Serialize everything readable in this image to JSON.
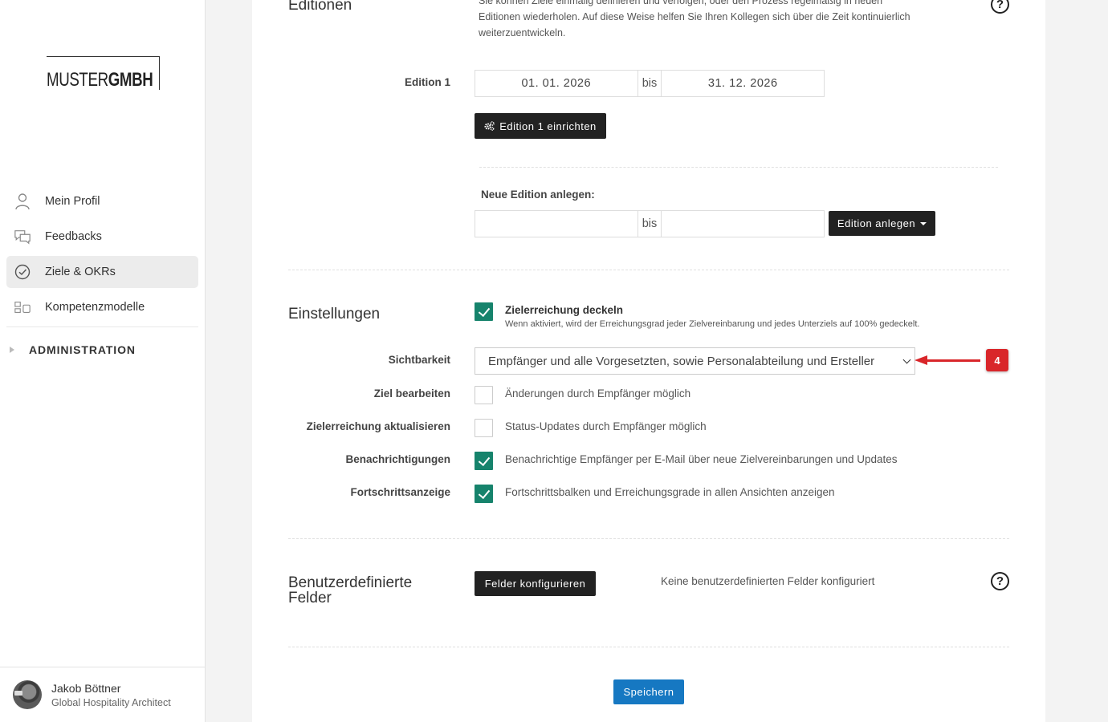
{
  "sidebar": {
    "logo": {
      "light": "MUSTER",
      "bold": "GMBH"
    },
    "nav": [
      {
        "label": "Mein Profil",
        "icon": "user-icon"
      },
      {
        "label": "Feedbacks",
        "icon": "chat-bubbles-icon"
      },
      {
        "label": "Ziele & OKRs",
        "icon": "check-circle-icon",
        "active": true
      },
      {
        "label": "Kompetenzmodelle",
        "icon": "competency-icon"
      }
    ],
    "admin_label": "ADMINISTRATION",
    "user": {
      "name": "Jakob Böttner",
      "role": "Global Hospitality Architect"
    }
  },
  "editionen": {
    "title": "Editionen",
    "intro": "Sie können Ziele einmalig definieren und verfolgen, oder den Prozess regelmäßig in neuen Editionen wiederholen. Auf diese Weise helfen Sie Ihren Kollegen sich über die Zeit kontinuierlich weiterzuentwickeln.",
    "edition1": {
      "label": "Edition 1",
      "start": "01. 01. 2026",
      "bis": "bis",
      "end": "31. 12. 2026",
      "button": "Edition 1 einrichten"
    },
    "neue": {
      "label": "Neue Edition anlegen:",
      "start": "",
      "bis": "bis",
      "end": "",
      "button": "Edition anlegen"
    }
  },
  "einstellungen": {
    "title": "Einstellungen",
    "deckeln": {
      "title": "Zielerreichung deckeln",
      "desc": "Wenn aktiviert, wird der Erreichungsgrad jeder Zielvereinbarung und jedes Unterziels auf 100% gedeckelt.",
      "checked": true
    },
    "sichtbarkeit": {
      "label": "Sichtbarkeit",
      "value": "Empfänger und alle Vorgesetzten, sowie Personalabteilung und Ersteller"
    },
    "rows": [
      {
        "label": "Ziel bearbeiten",
        "text": "Änderungen durch Empfänger möglich",
        "checked": false
      },
      {
        "label": "Zielerreichung aktualisieren",
        "text": "Status-Updates durch Empfänger möglich",
        "checked": false
      },
      {
        "label": "Benachrichtigungen",
        "text": "Benachrichtige Empfänger per E-Mail über neue Zielvereinbarungen und Updates",
        "checked": true
      },
      {
        "label": "Fortschrittsanzeige",
        "text": "Fortschrittsbalken und Erreichungsgrade in allen Ansichten anzeigen",
        "checked": true
      }
    ]
  },
  "custom_fields": {
    "title_line1": "Benutzerdefinierte",
    "title_line2": "Felder",
    "button": "Felder konfigurieren",
    "note": "Keine benutzerdefinierten Felder konfiguriert"
  },
  "annotation": {
    "badge": "4",
    "color": "#d9262a"
  },
  "save_label": "Speichern",
  "help_glyph": "?",
  "colors": {
    "checkbox": "#16836c",
    "save": "#1678c2",
    "dark_button": "#222222"
  }
}
